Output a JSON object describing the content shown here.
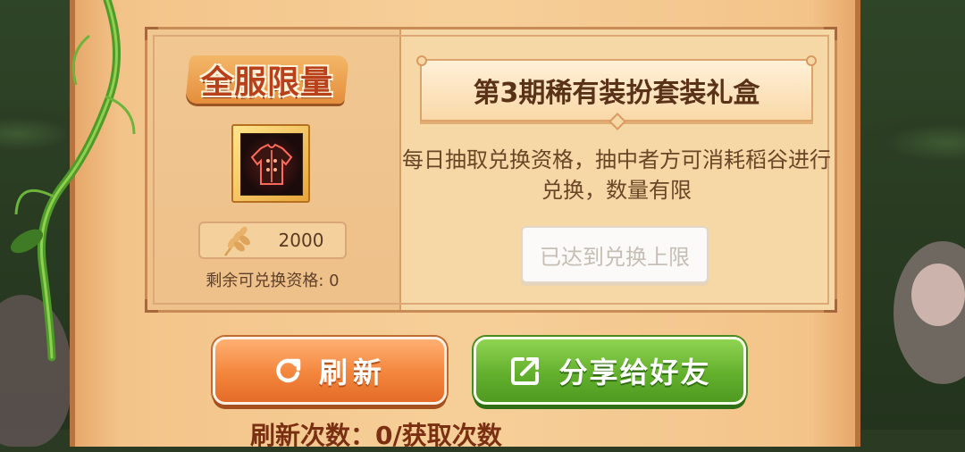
{
  "card": {
    "limited_tag": "全服限量",
    "price": "2000",
    "remaining_label": "剩余可兑换资格: 0",
    "title": "第3期稀有装扮套装礼盒",
    "description": "每日抽取兑换资格，抽中者方可消耗稻谷进行兑换，数量有限",
    "exchange_button": "已达到兑换上限"
  },
  "buttons": {
    "refresh": "刷新",
    "share": "分享给好友"
  },
  "footer": {
    "partial_text": "刷新次数：0/获取次数"
  },
  "colors": {
    "refresh": "#f3853c",
    "share": "#63b02d",
    "panel": "#f6d7a6"
  },
  "icons": [
    "refresh-icon",
    "share-icon",
    "wheat-icon",
    "costume-item-icon"
  ]
}
